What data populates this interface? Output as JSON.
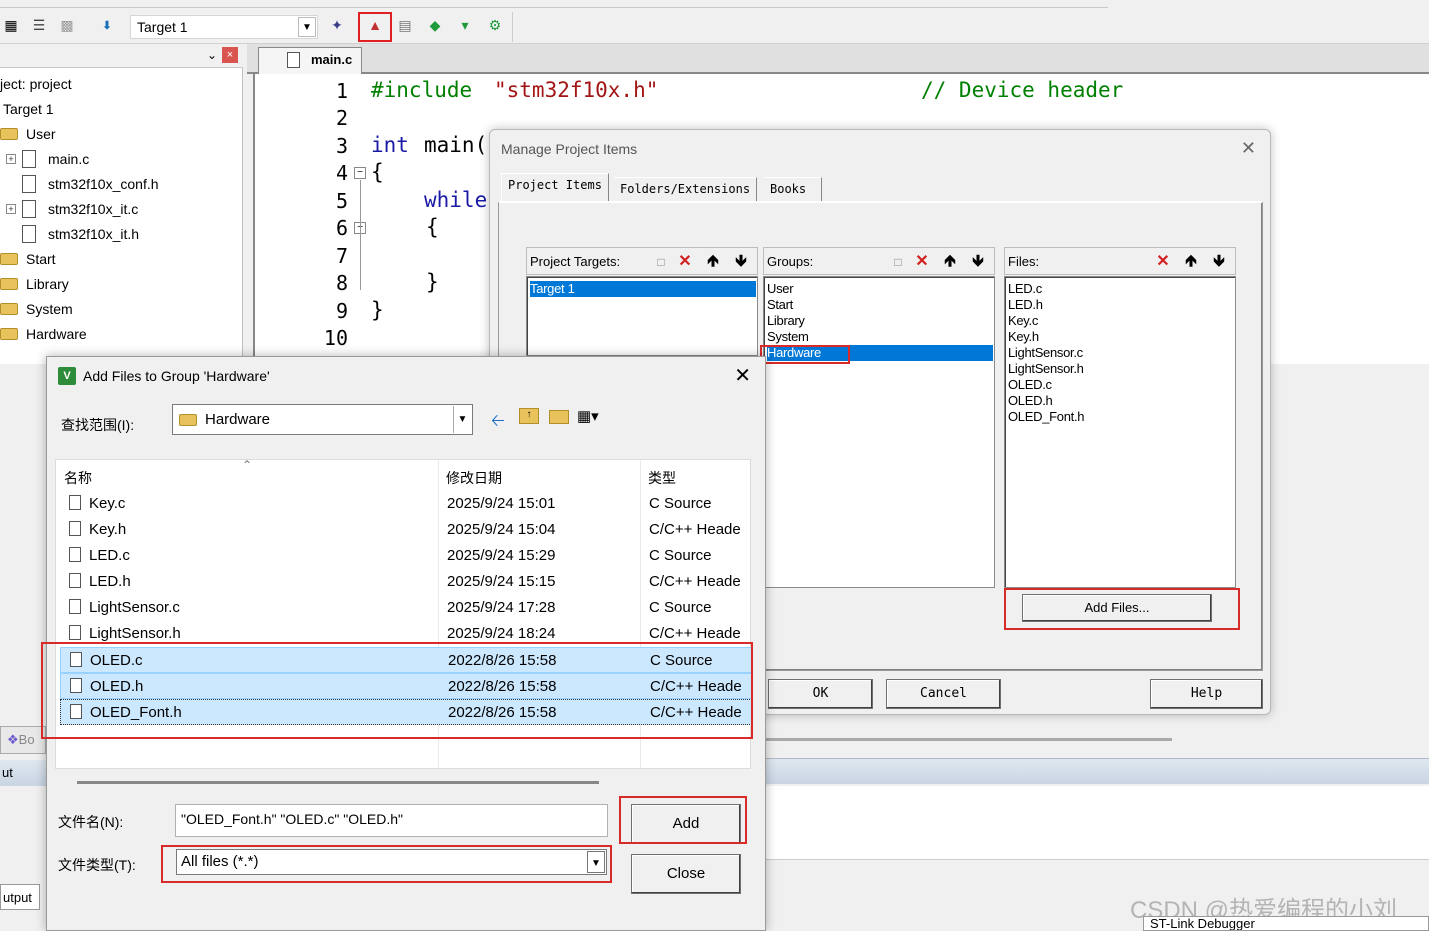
{
  "toolbar": {
    "target_name": "Target 1",
    "icons": [
      "download-icon",
      "batch-build-icon",
      "load-icon",
      "target-options-icon",
      "manage-project-icon",
      "books-icon",
      "pack-installer-icon",
      "debug-icon"
    ]
  },
  "project_panel": {
    "root": "ject: project",
    "items": [
      {
        "label": "Target 1",
        "type": "target"
      },
      {
        "label": "User",
        "type": "group"
      },
      {
        "label": "main.c",
        "type": "file"
      },
      {
        "label": "stm32f10x_conf.h",
        "type": "file"
      },
      {
        "label": "stm32f10x_it.c",
        "type": "file"
      },
      {
        "label": "stm32f10x_it.h",
        "type": "file"
      },
      {
        "label": "Start",
        "type": "group"
      },
      {
        "label": "Library",
        "type": "group"
      },
      {
        "label": "System",
        "type": "group"
      },
      {
        "label": "Hardware",
        "type": "group"
      }
    ],
    "pin_glyph": "📌",
    "close_glyph": "×"
  },
  "editor": {
    "tab": "main.c",
    "line_numbers": [
      "1",
      "2",
      "3",
      "4",
      "5",
      "6",
      "7",
      "8",
      "9",
      "10"
    ],
    "code": {
      "l1_directive": "#include",
      "l1_string": "\"stm32f10x.h\"",
      "l1_comment": "// Device header",
      "l3_type": "int",
      "l3_name": "main(",
      "l4": "{",
      "l5": "while",
      "l6": "{",
      "l8": "}",
      "l9": "}"
    }
  },
  "manage_dialog": {
    "title": "Manage Project Items",
    "tabs": [
      "Project Items",
      "Folders/Extensions",
      "Books"
    ],
    "targets_label": "Project Targets:",
    "groups_label": "Groups:",
    "files_label": "Files:",
    "targets": [
      "Target 1"
    ],
    "groups": [
      "User",
      "Start",
      "Library",
      "System",
      "Hardware"
    ],
    "selected_group": "Hardware",
    "files": [
      "LED.c",
      "LED.h",
      "Key.c",
      "Key.h",
      "LightSensor.c",
      "LightSensor.h",
      "OLED.c",
      "OLED.h",
      "OLED_Font.h"
    ],
    "add_files_button": "Add Files...",
    "ok": "OK",
    "cancel": "Cancel",
    "help": "Help"
  },
  "add_files_dialog": {
    "title": "Add Files to Group 'Hardware'",
    "look_in_label": "查找范围(I):",
    "look_in_value": "Hardware",
    "columns": {
      "name": "名称",
      "date": "修改日期",
      "type": "类型"
    },
    "rows": [
      {
        "name": "Key.c",
        "date": "2025/9/24 15:01",
        "type": "C Source",
        "selected": false
      },
      {
        "name": "Key.h",
        "date": "2025/9/24 15:04",
        "type": "C/C++ Heade",
        "selected": false
      },
      {
        "name": "LED.c",
        "date": "2025/9/24 15:29",
        "type": "C Source",
        "selected": false
      },
      {
        "name": "LED.h",
        "date": "2025/9/24 15:15",
        "type": "C/C++ Heade",
        "selected": false
      },
      {
        "name": "LightSensor.c",
        "date": "2025/9/24 17:28",
        "type": "C Source",
        "selected": false
      },
      {
        "name": "LightSensor.h",
        "date": "2025/9/24 18:24",
        "type": "C/C++ Heade",
        "selected": false
      },
      {
        "name": "OLED.c",
        "date": "2022/8/26 15:58",
        "type": "C Source",
        "selected": true
      },
      {
        "name": "OLED.h",
        "date": "2022/8/26 15:58",
        "type": "C/C++ Heade",
        "selected": true
      },
      {
        "name": "OLED_Font.h",
        "date": "2022/8/26 15:58",
        "type": "C/C++ Heade",
        "selected": true
      }
    ],
    "filename_label": "文件名(N):",
    "filename_value": "\"OLED_Font.h\" \"OLED.c\" \"OLED.h\"",
    "filetype_label": "文件类型(T):",
    "filetype_value": "All files (*.*)",
    "add_button": "Add",
    "close_button": "Close"
  },
  "background": {
    "books_tab": "Bo",
    "output_label_1": "ut",
    "output_label_2": "utput",
    "watermark": "CSDN @热爱编程的小刘",
    "status": "ST-Link Debugger"
  },
  "colors": {
    "selection_blue": "#0078d7",
    "highlight_red": "#d92a2a",
    "keyword_blue": "#1a1aa6",
    "string_red": "#a31515",
    "comment_green": "#008000",
    "row_selected": "#cce8ff"
  }
}
